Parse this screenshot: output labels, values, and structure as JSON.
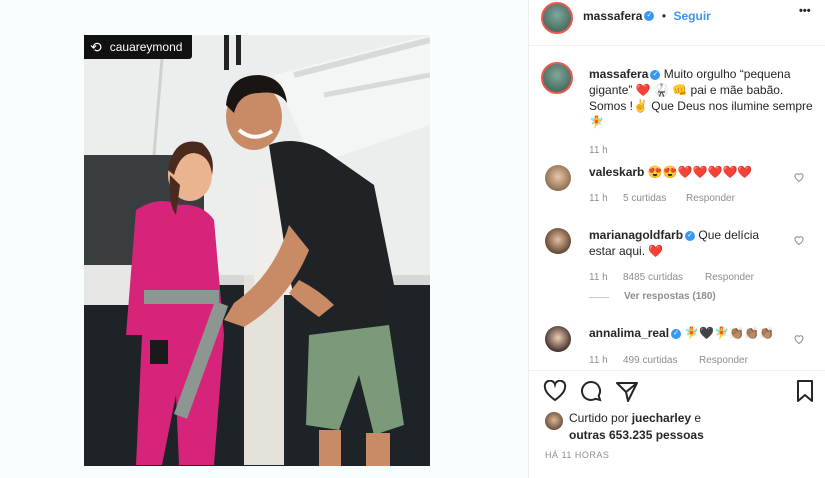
{
  "repost": {
    "username": "cauareymond"
  },
  "header": {
    "username": "massafera",
    "follow_label": "Seguir",
    "more_label": "•••"
  },
  "caption": {
    "username": "massafera",
    "text": "Muito orgulho “pequena gigante” ❤️ 🥋 👊 pai e mãe babão. Somos !✌️ Que Deus nos ilumine sempre🧚",
    "time": "11 h"
  },
  "comments": [
    {
      "username": "valeskarb",
      "verified": false,
      "text": "😍😍❤️❤️❤️❤️❤️",
      "time": "11 h",
      "likes": "5 curtidas",
      "reply": "Responder"
    },
    {
      "username": "marianagoldfarb",
      "verified": true,
      "text": "Que delícia estar aqui. ❤️",
      "time": "11 h",
      "likes": "8485 curtidas",
      "reply": "Responder",
      "view_replies": "Ver respostas (180)"
    },
    {
      "username": "annalima_real",
      "verified": true,
      "text": "🧚🖤🧚👏🏽👏🏽👏🏽",
      "time": "11 h",
      "likes": "499 curtidas",
      "reply": "Responder"
    }
  ],
  "likes": {
    "prefix": "Curtido por ",
    "user": "juecharley",
    "mid": " e",
    "others": "outras 653.235 pessoas"
  },
  "timestamp": "HÁ 11 HORAS",
  "colors": {
    "accent": "#3897f0",
    "heart": "#ed4956",
    "gi": "#d6247a"
  }
}
